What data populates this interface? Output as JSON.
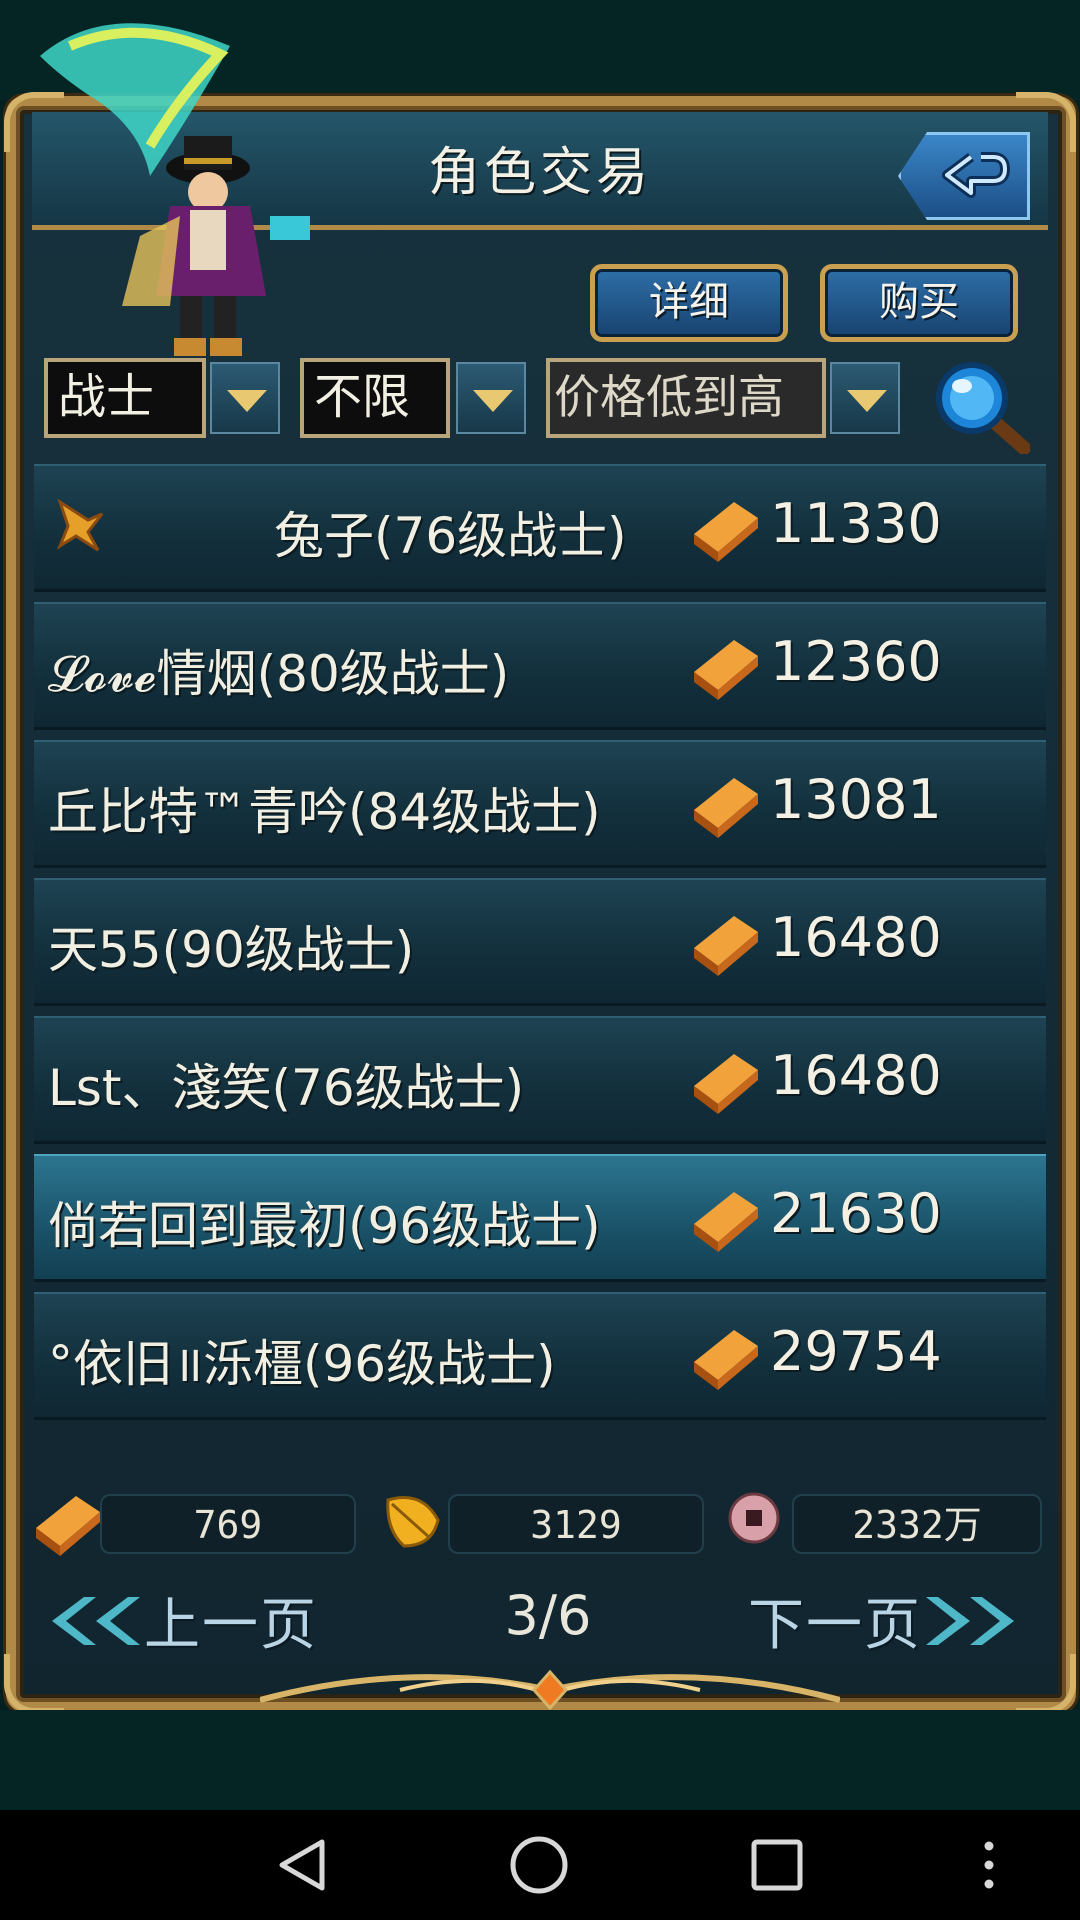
{
  "header": {
    "title": "角色交易"
  },
  "actions": {
    "detail_label": "详细",
    "buy_label": "购买"
  },
  "filters": {
    "class_value": "战士",
    "level_value": "不限",
    "sort_value": "价格低到高"
  },
  "listings": [
    {
      "name": "兔子(76级战士)",
      "price": "11330",
      "badge": true
    },
    {
      "name": "𝓛𝓸𝓿𝓮情烟(80级战士)",
      "price": "12360"
    },
    {
      "name": "丘比特™青吟(84级战士)",
      "price": "13081"
    },
    {
      "name": "天55(90级战士)",
      "price": "16480"
    },
    {
      "name": "Lst、淺笑(76级战士)",
      "price": "16480"
    },
    {
      "name": "倘若回到最初(96级战士)",
      "price": "21630",
      "selected": true
    },
    {
      "name": "°依旧॥泺橿(96级战士)",
      "price": "29754"
    }
  ],
  "currency": {
    "gold": "769",
    "leaf": "3129",
    "coin": "2332万"
  },
  "pagination": {
    "prev_label": "上一页",
    "next_label": "下一页",
    "page_indicator": "3/6"
  },
  "colors": {
    "frame_gold": "#b08a46",
    "row_bg": "#13303d",
    "selected_row": "#1a5268",
    "button_blue": "#2e6fa8"
  },
  "icons": [
    "back-arrow-icon",
    "magnifier-icon",
    "gold-ingot-icon",
    "leaf-icon",
    "coin-icon",
    "star-badge-icon"
  ]
}
